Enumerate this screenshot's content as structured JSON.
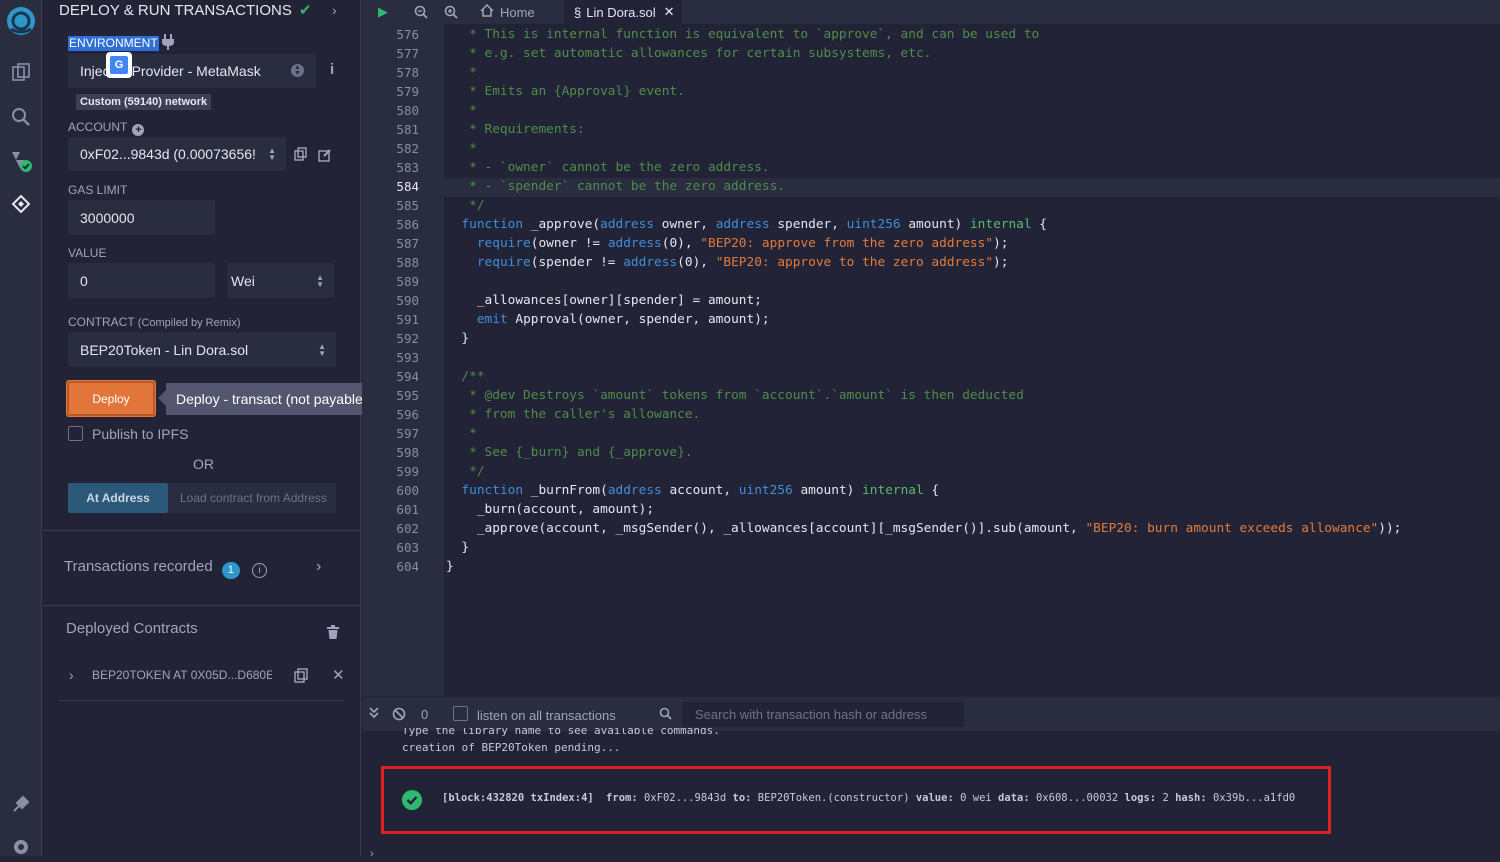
{
  "panel": {
    "title": "DEPLOY & RUN TRANSACTIONS",
    "environment_label": "ENVIRONMENT",
    "environment_value": "Injected Provider - MetaMask",
    "environment_value_left": "Injec",
    "environment_value_right": "Provider - MetaMask",
    "network_badge": "Custom (59140) network",
    "account_label": "ACCOUNT",
    "account_value": "0xF02...9843d (0.00073656!",
    "gas_limit_label": "GAS LIMIT",
    "gas_limit_value": "3000000",
    "value_label": "VALUE",
    "value_amount": "0",
    "value_unit": "Wei",
    "contract_label": "CONTRACT",
    "contract_sublabel": "(Compiled by Remix)",
    "contract_value": "BEP20Token - Lin Dora.sol",
    "deploy_button": "Deploy",
    "deploy_tooltip": "Deploy - transact (not payable)",
    "publish_ipfs_label": "Publish to IPFS",
    "or_label": "OR",
    "at_address_button": "At Address",
    "load_contract_placeholder": "Load contract from Address",
    "transactions_recorded_label": "Transactions recorded",
    "transactions_recorded_count": "1",
    "deployed_contracts_label": "Deployed Contracts",
    "deployed_contract_item": "BEP20TOKEN AT 0X05D...D680E"
  },
  "tabs": {
    "home_label": "Home",
    "file_tab_label": "Lin Dora.sol"
  },
  "editor": {
    "active_line": "584",
    "lines": [
      {
        "n": "576",
        "html": "<span class=\"cm\">   * This is internal function is equivalent to `approve`, and can be used to</span>"
      },
      {
        "n": "577",
        "html": "<span class=\"cm\">   * e.g. set automatic allowances for certain subsystems, etc.</span>"
      },
      {
        "n": "578",
        "html": "<span class=\"cm\">   *</span>"
      },
      {
        "n": "579",
        "html": "<span class=\"cm\">   * Emits an {Approval} event.</span>"
      },
      {
        "n": "580",
        "html": "<span class=\"cm\">   *</span>"
      },
      {
        "n": "581",
        "html": "<span class=\"cm\">   * Requirements:</span>"
      },
      {
        "n": "582",
        "html": "<span class=\"cm\">   *</span>"
      },
      {
        "n": "583",
        "html": "<span class=\"cm\">   * - `owner` cannot be the zero address.</span>"
      },
      {
        "n": "584",
        "html": "<span class=\"cm\">   * - `spender` cannot be the zero address.</span>"
      },
      {
        "n": "585",
        "html": "<span class=\"cm\">   */</span>"
      },
      {
        "n": "586",
        "html": "  <span class=\"kw\">function</span> _approve(<span class=\"kw\">address</span> owner, <span class=\"kw\">address</span> spender, <span class=\"kw\">uint256</span> amount) <span class=\"inl\">internal</span> {"
      },
      {
        "n": "587",
        "html": "    <span class=\"req\">require</span>(owner != <span class=\"kw\">address</span>(0), <span class=\"str\">\"BEP20: approve from the zero address\"</span>);"
      },
      {
        "n": "588",
        "html": "    <span class=\"req\">require</span>(spender != <span class=\"kw\">address</span>(0), <span class=\"str\">\"BEP20: approve to the zero address\"</span>);"
      },
      {
        "n": "589",
        "html": ""
      },
      {
        "n": "590",
        "html": "    _allowances[owner][spender] = amount;"
      },
      {
        "n": "591",
        "html": "    <span class=\"kw\">emit</span> Approval(owner, spender, amount);"
      },
      {
        "n": "592",
        "html": "  }"
      },
      {
        "n": "593",
        "html": ""
      },
      {
        "n": "594",
        "html": "<span class=\"cm\">  /**</span>"
      },
      {
        "n": "595",
        "html": "<span class=\"cm\">   * @dev Destroys `amount` tokens from `account`.`amount` is then deducted</span>"
      },
      {
        "n": "596",
        "html": "<span class=\"cm\">   * from the caller's allowance.</span>"
      },
      {
        "n": "597",
        "html": "<span class=\"cm\">   *</span>"
      },
      {
        "n": "598",
        "html": "<span class=\"cm\">   * See {_burn} and {_approve}.</span>"
      },
      {
        "n": "599",
        "html": "<span class=\"cm\">   */</span>"
      },
      {
        "n": "600",
        "html": "  <span class=\"kw\">function</span> _burnFrom(<span class=\"kw\">address</span> account, <span class=\"kw\">uint256</span> amount) <span class=\"inl\">internal</span> {"
      },
      {
        "n": "601",
        "html": "    _burn(account, amount);"
      },
      {
        "n": "602",
        "html": "    _approve(account, _msgSender(), _allowances[account][_msgSender()].sub(amount, <span class=\"str\">\"BEP20: burn amount exceeds allowance\"</span>));"
      },
      {
        "n": "603",
        "html": "  }"
      },
      {
        "n": "604",
        "html": "}"
      }
    ]
  },
  "terminal": {
    "pending_count": "0",
    "listen_label": "listen on all transactions",
    "search_placeholder": "Search with transaction hash or address",
    "line1": "Type the library name to see available commands.",
    "line2": "creation of BEP20Token pending...",
    "tx": {
      "block": "[block:432820 txIndex:4]",
      "from_label": "from:",
      "from_value": "0xF02...9843d",
      "to_label": "to:",
      "to_value": "BEP20Token.(constructor)",
      "value_label": "value:",
      "value_value": "0 wei",
      "data_label": "data:",
      "data_value": "0x608...00032",
      "logs_label": "logs:",
      "logs_value": "2",
      "hash_label": "hash:",
      "hash_value": "0x39b...a1fd0"
    }
  },
  "colors": {
    "accent": "#e2763a",
    "highlight_border": "#e02020",
    "success": "#2eb872",
    "badge": "#2d97c9"
  }
}
